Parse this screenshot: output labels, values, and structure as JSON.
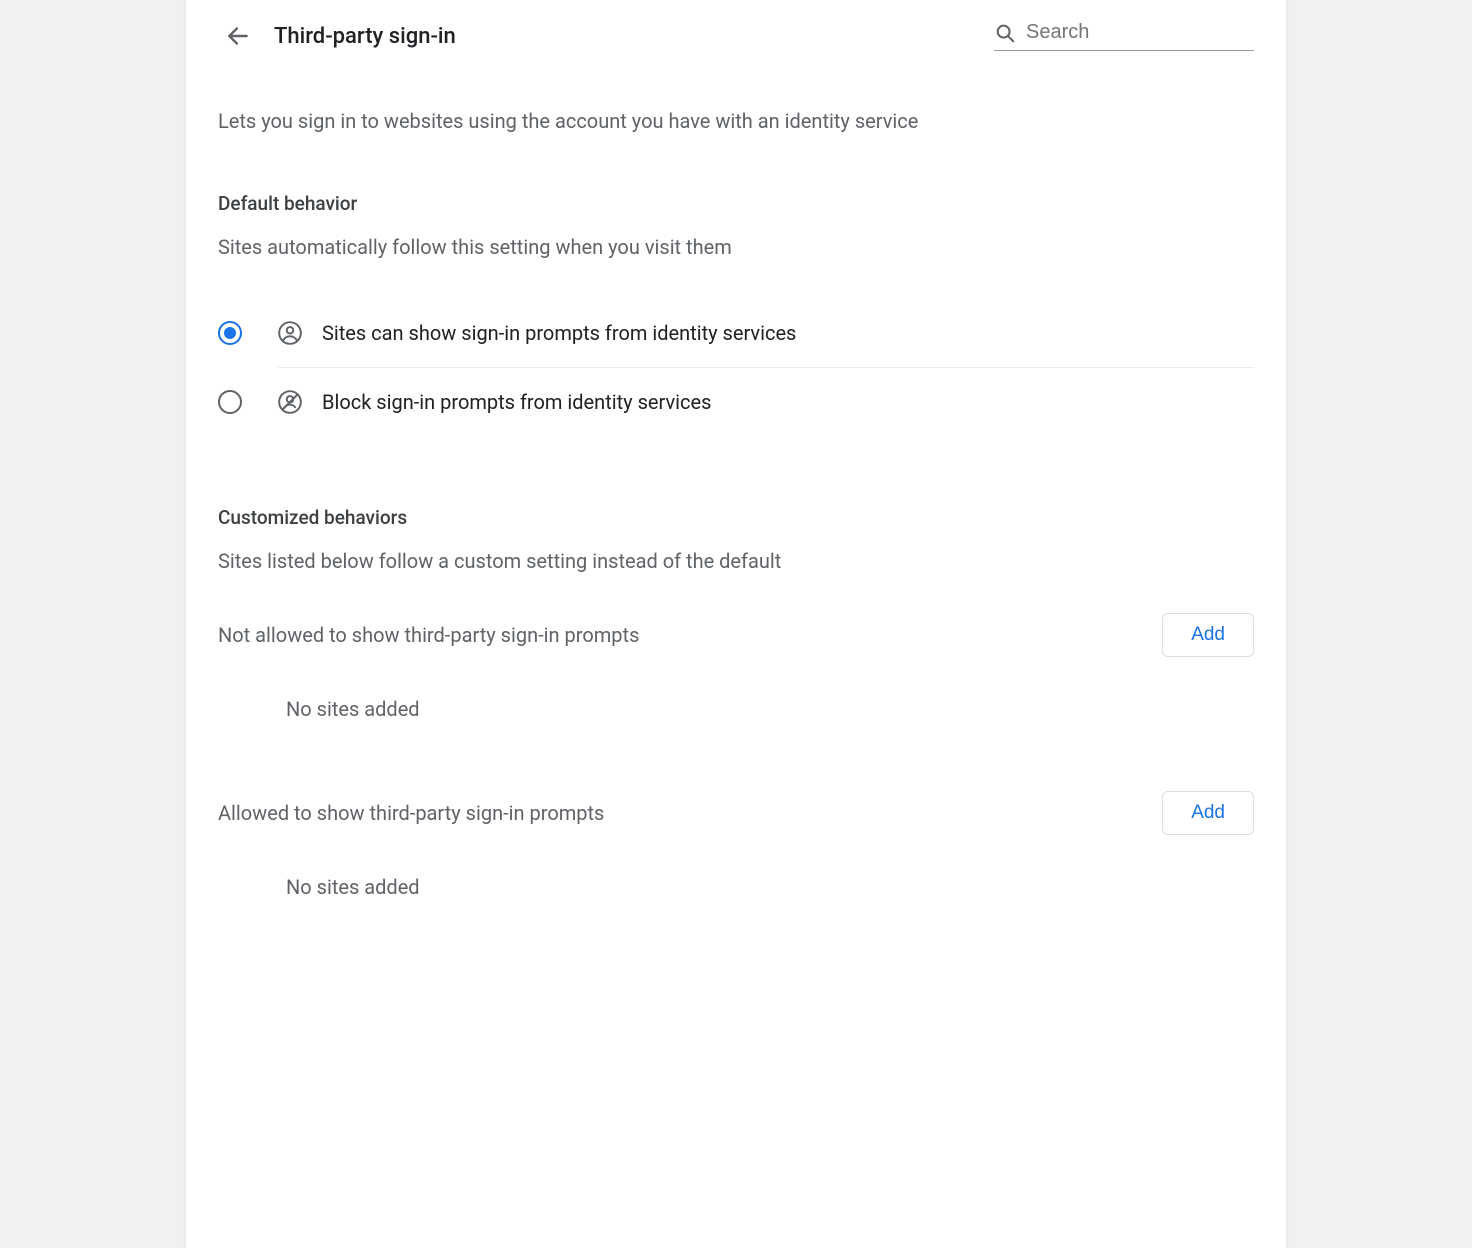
{
  "header": {
    "title": "Third-party sign-in",
    "search_placeholder": "Search"
  },
  "main": {
    "description": "Lets you sign in to websites using the account you have with an identity service",
    "default_section": {
      "title": "Default behavior",
      "subtitle": "Sites automatically follow this setting when you visit them",
      "options": [
        {
          "label": "Sites can show sign-in prompts from identity services",
          "selected": true
        },
        {
          "label": "Block sign-in prompts from identity services",
          "selected": false
        }
      ]
    },
    "custom_section": {
      "title": "Customized behaviors",
      "subtitle": "Sites listed below follow a custom setting instead of the default",
      "lists": [
        {
          "label": "Not allowed to show third-party sign-in prompts",
          "add_label": "Add",
          "empty": "No sites added"
        },
        {
          "label": "Allowed to show third-party sign-in prompts",
          "add_label": "Add",
          "empty": "No sites added"
        }
      ]
    }
  }
}
